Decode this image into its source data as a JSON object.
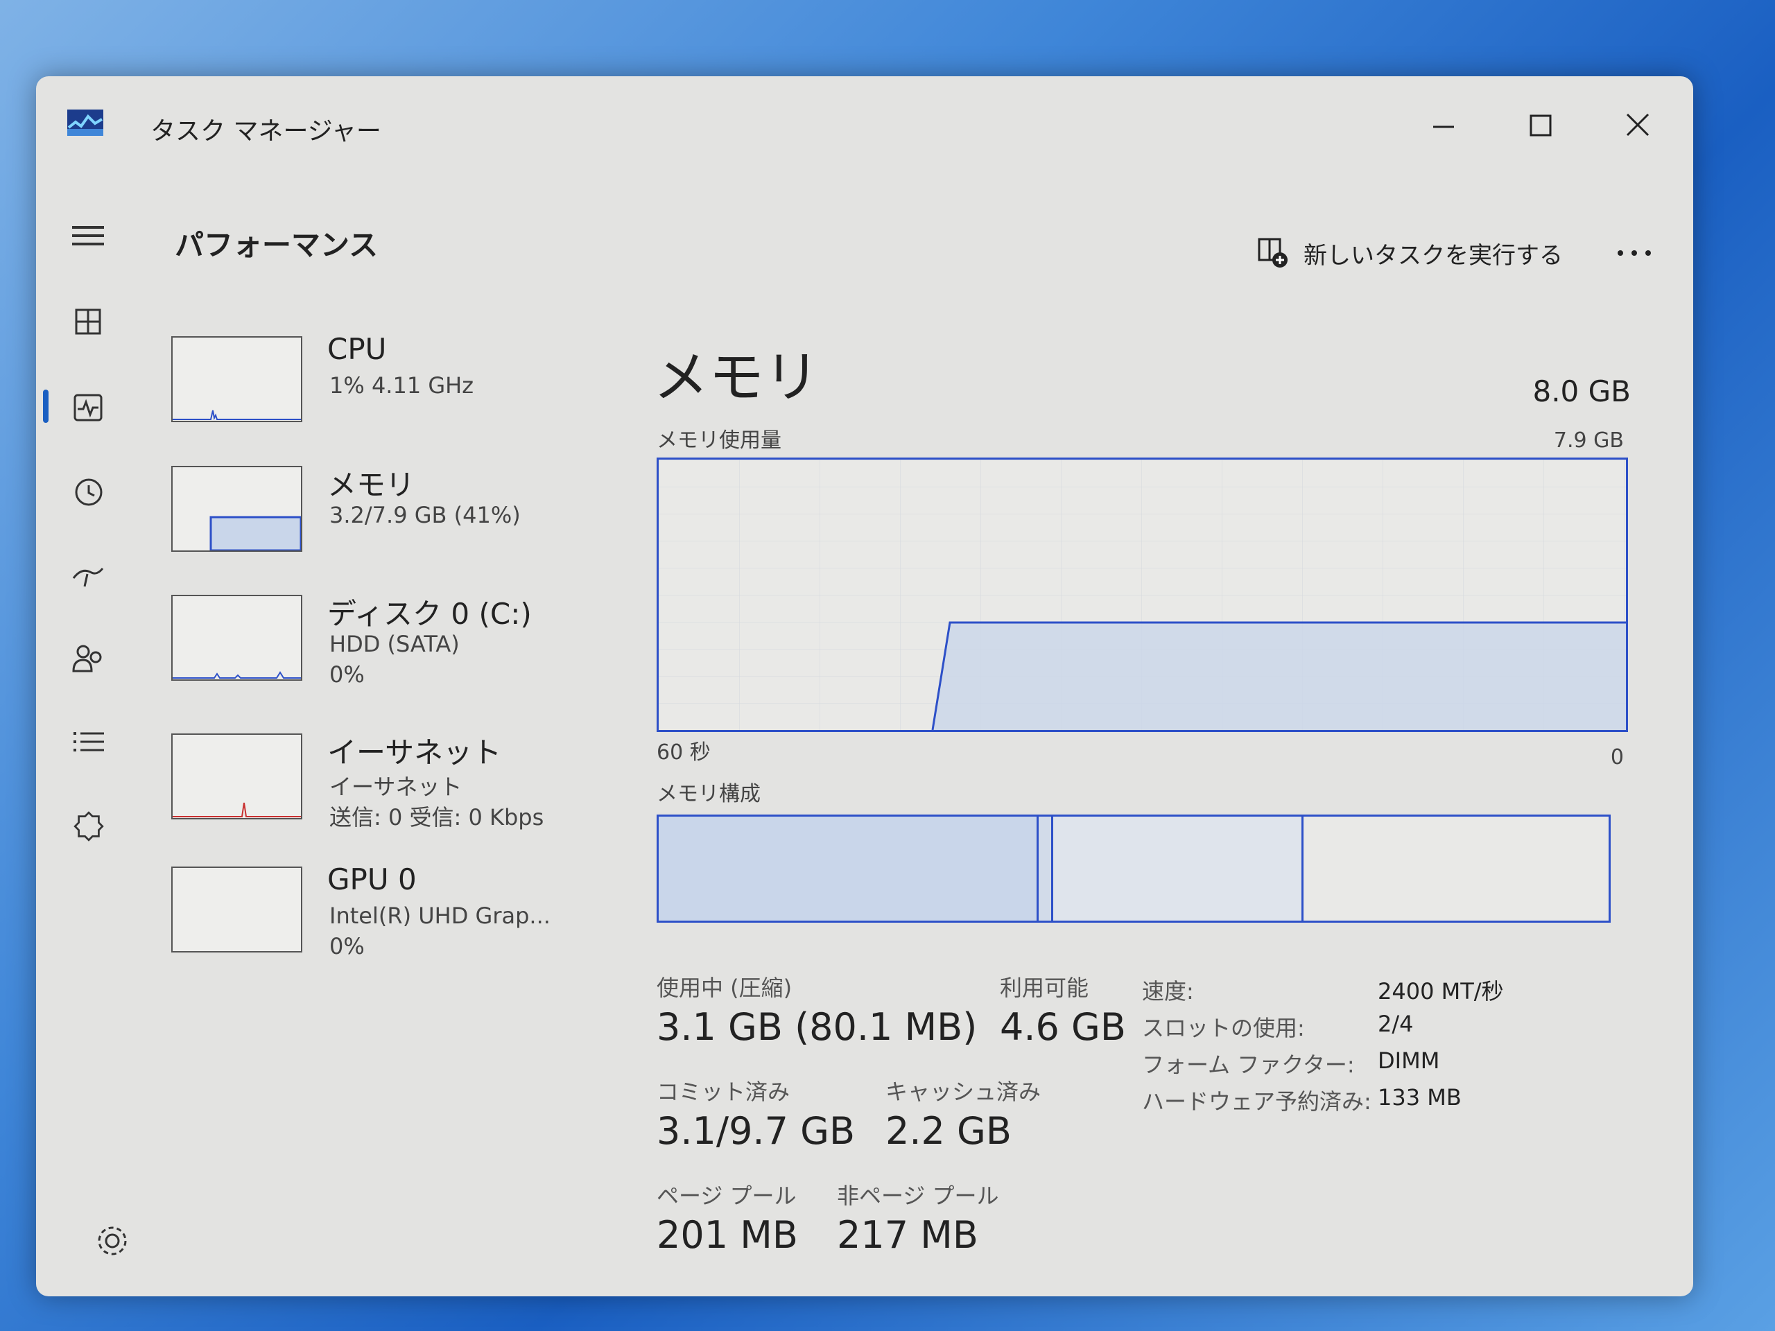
{
  "window": {
    "title": "タスク マネージャー"
  },
  "header": {
    "section_title": "パフォーマンス",
    "run_task_label": "新しいタスクを実行する"
  },
  "nav": {
    "items": [
      "menu-icon",
      "processes-icon",
      "performance-icon",
      "app-history-icon",
      "startup-icon",
      "users-icon",
      "details-icon",
      "services-icon"
    ],
    "selected": "performance-icon",
    "settings": "gear-icon"
  },
  "devices": [
    {
      "name": "CPU",
      "line1": "1% 4.11 GHz",
      "line2": ""
    },
    {
      "name": "メモリ",
      "line1": "3.2/7.9 GB (41%)",
      "line2": ""
    },
    {
      "name": "ディスク 0 (C:)",
      "line1": "HDD (SATA)",
      "line2": "0%"
    },
    {
      "name": "イーサネット",
      "line1": "イーサネット",
      "line2": "送信: 0 受信: 0 Kbps"
    },
    {
      "name": "GPU 0",
      "line1": "Intel(R) UHD Grap...",
      "line2": "0%"
    }
  ],
  "memory": {
    "title": "メモリ",
    "total": "8.0 GB",
    "usage_label": "メモリ使用量",
    "usage_max": "7.9 GB",
    "time_left": "60 秒",
    "time_right": "0",
    "composition_label": "メモリ構成",
    "stats": {
      "in_use_label": "使用中 (圧縮)",
      "in_use_value": "3.1 GB (80.1 MB)",
      "available_label": "利用可能",
      "available_value": "4.6 GB",
      "committed_label": "コミット済み",
      "committed_value": "3.1/9.7 GB",
      "cached_label": "キャッシュ済み",
      "cached_value": "2.2 GB",
      "paged_label": "ページ プール",
      "paged_value": "201 MB",
      "nonpaged_label": "非ページ プール",
      "nonpaged_value": "217 MB"
    },
    "details": {
      "speed_k": "速度:",
      "speed_v": "2400 MT/秒",
      "slots_k": "スロットの使用:",
      "slots_v": "2/4",
      "form_k": "フォーム ファクター:",
      "form_v": "DIMM",
      "hwres_k": "ハードウェア予約済み:",
      "hwres_v": "133 MB"
    }
  },
  "colors": {
    "accent": "#2d50c8",
    "fill": "#c9d6ea",
    "window_bg": "#e3e3e1"
  }
}
